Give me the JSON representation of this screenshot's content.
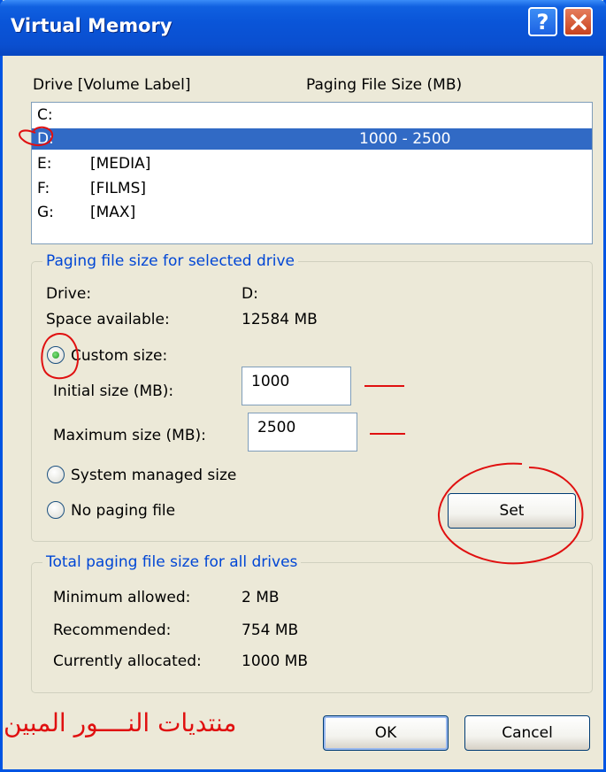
{
  "window": {
    "title": "Virtual Memory",
    "help_glyph": "?",
    "accent_color": "#0a4fd0"
  },
  "drives": {
    "headers": {
      "drive": "Drive  [Volume Label]",
      "paging": "Paging File Size (MB)"
    },
    "rows": [
      {
        "letter": "C:",
        "label": "",
        "size": "",
        "selected": false
      },
      {
        "letter": "D:",
        "label": "",
        "size": "1000 - 2500",
        "selected": true
      },
      {
        "letter": "E:",
        "label": "[MEDIA]",
        "size": "",
        "selected": false
      },
      {
        "letter": "F:",
        "label": "[FILMS]",
        "size": "",
        "selected": false
      },
      {
        "letter": "G:",
        "label": "[MAX]",
        "size": "",
        "selected": false
      }
    ]
  },
  "selected_drive": {
    "group_title": "Paging file size for selected drive",
    "drive_label": "Drive:",
    "drive_value": "D:",
    "space_label": "Space available:",
    "space_value": "12584 MB",
    "custom_size_label": "Custom size:",
    "initial_label": "Initial size (MB):",
    "initial_value": "1000",
    "maximum_label": "Maximum size (MB):",
    "maximum_value": "2500",
    "system_managed_label": "System managed size",
    "no_paging_label": "No paging file",
    "selected_option": "custom",
    "set_label": "Set"
  },
  "totals": {
    "group_title": "Total paging file size for all drives",
    "minimum_label": "Minimum allowed:",
    "minimum_value": "2 MB",
    "recommended_label": "Recommended:",
    "recommended_value": "754 MB",
    "allocated_label": "Currently allocated:",
    "allocated_value": "1000 MB"
  },
  "footer": {
    "watermark": "منتديات النــــور المبين",
    "ok_label": "OK",
    "cancel_label": "Cancel"
  },
  "annotation_color": "#e01010"
}
